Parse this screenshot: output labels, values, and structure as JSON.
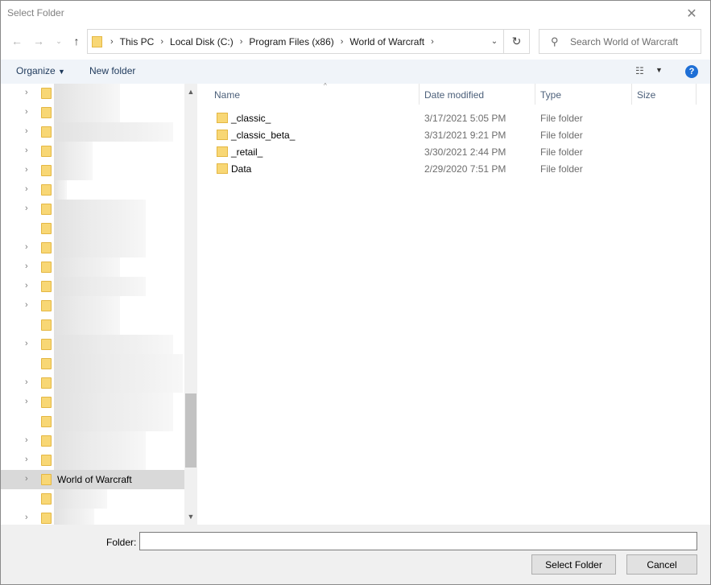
{
  "window": {
    "title": "Select Folder"
  },
  "nav": {
    "back_icon": "back-arrow-icon",
    "forward_icon": "forward-arrow-icon",
    "recent_icon": "chevron-down-icon",
    "up_icon": "up-arrow-icon"
  },
  "address": {
    "breadcrumbs": [
      "This PC",
      "Local Disk (C:)",
      "Program Files (x86)",
      "World of Warcraft"
    ]
  },
  "search": {
    "placeholder": "Search World of Warcraft"
  },
  "toolbar": {
    "organize": "Organize",
    "new_folder": "New folder",
    "help": "?"
  },
  "tree": {
    "selected_label": "World of Warcraft"
  },
  "columns": {
    "name": "Name",
    "date_modified": "Date modified",
    "type": "Type",
    "size": "Size"
  },
  "files": [
    {
      "name": "_classic_",
      "date": "3/17/2021 5:05 PM",
      "type": "File folder"
    },
    {
      "name": "_classic_beta_",
      "date": "3/31/2021 9:21 PM",
      "type": "File folder"
    },
    {
      "name": "_retail_",
      "date": "3/30/2021 2:44 PM",
      "type": "File folder"
    },
    {
      "name": "Data",
      "date": "2/29/2020 7:51 PM",
      "type": "File folder"
    }
  ],
  "footer": {
    "folder_label": "Folder:",
    "folder_value": "",
    "select_button": "Select Folder",
    "cancel_button": "Cancel"
  },
  "colors": {
    "accent": "#1e6fd6",
    "folder": "#f8d775",
    "selection": "#d9d9d9"
  }
}
